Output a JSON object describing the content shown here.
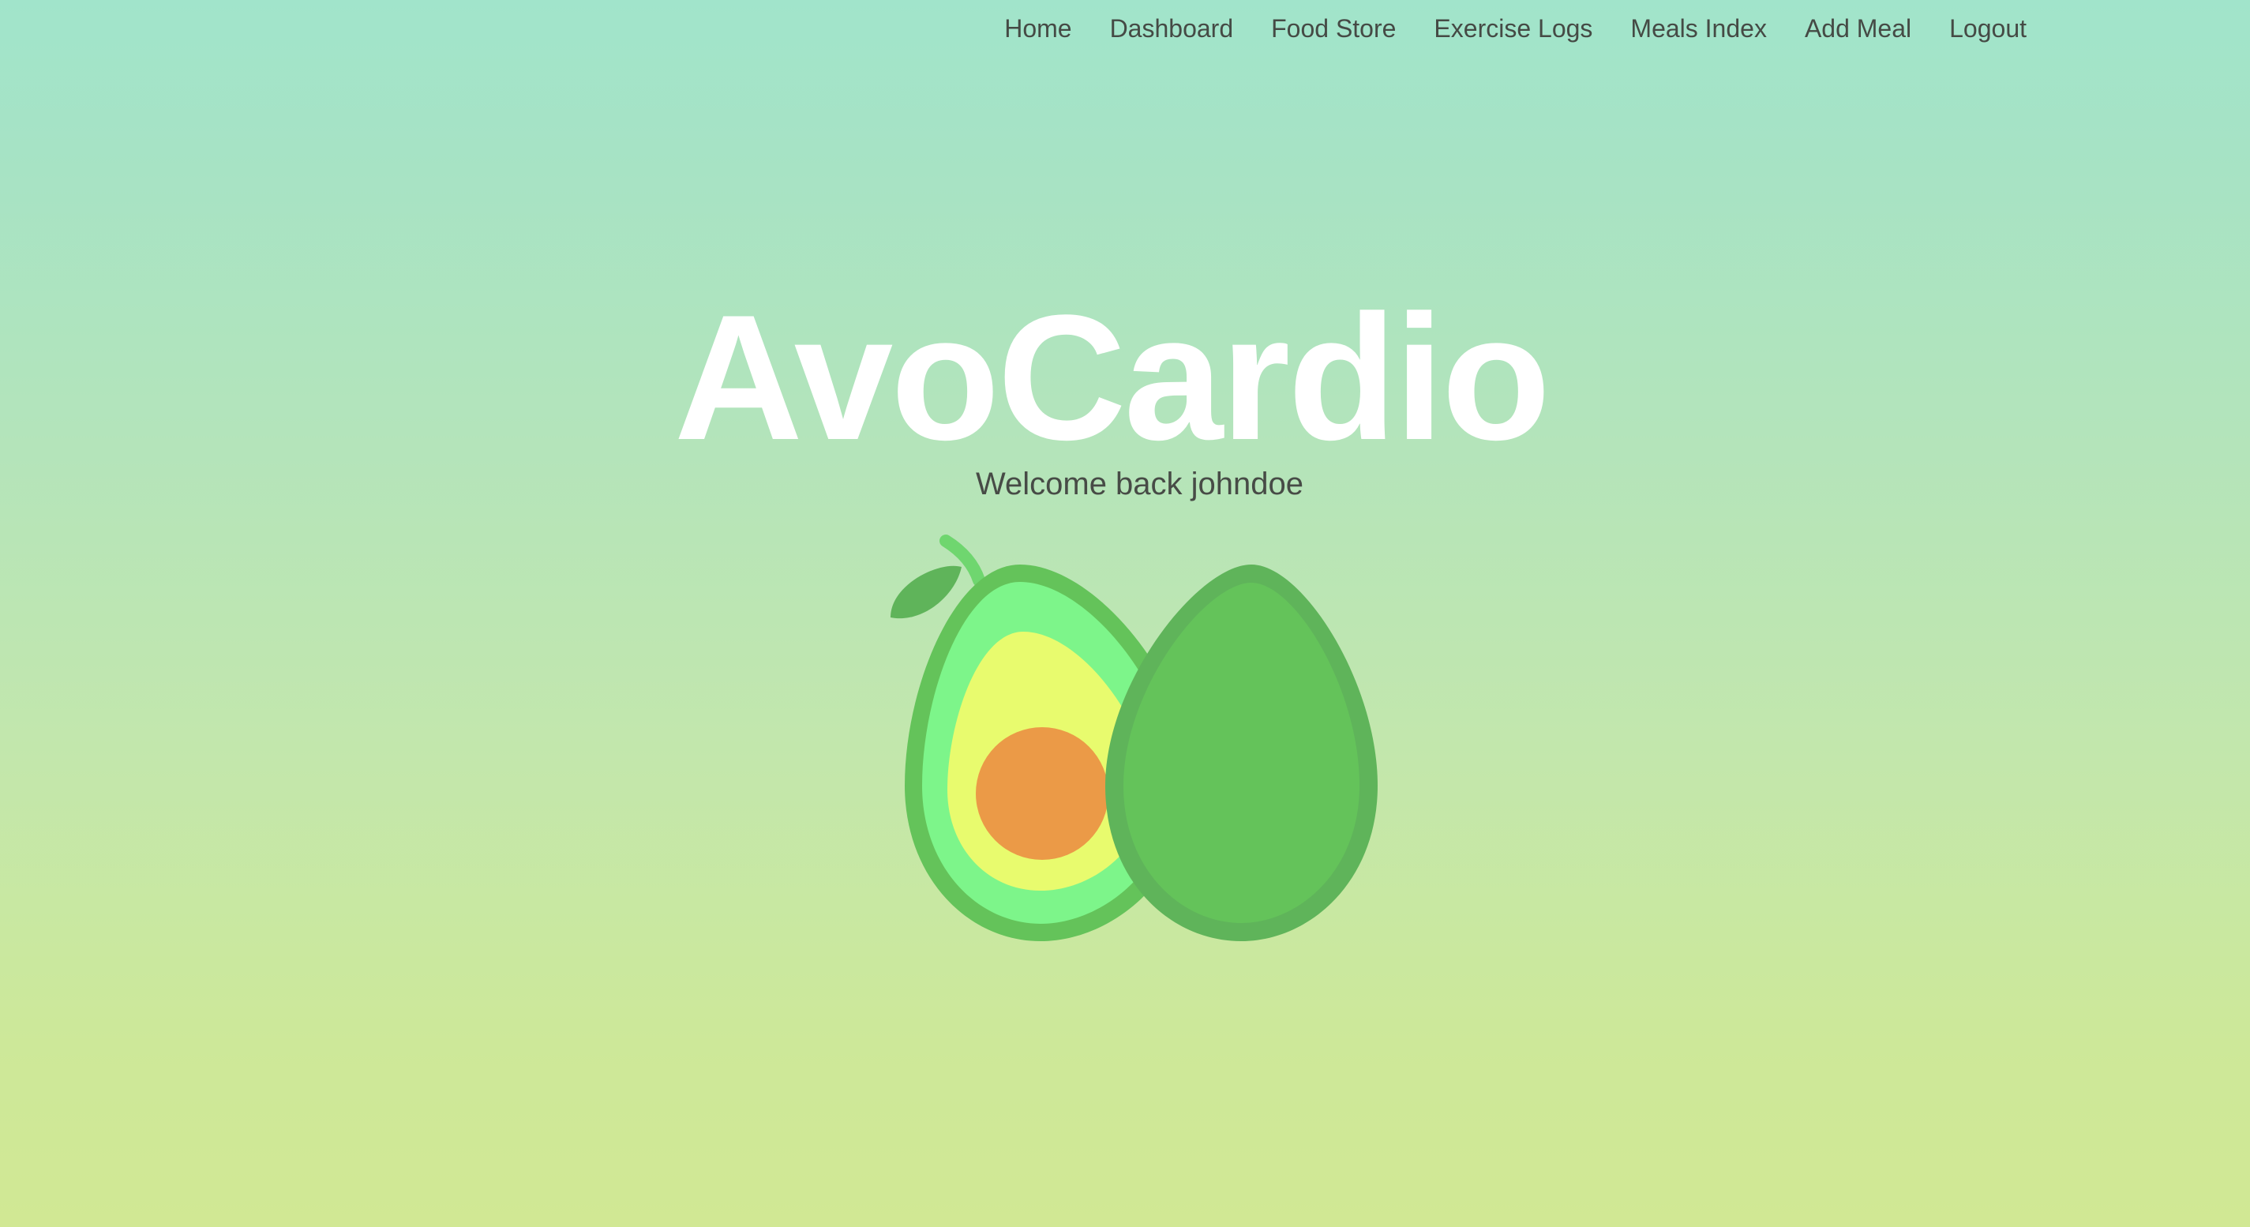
{
  "nav": {
    "items": [
      {
        "label": "Home"
      },
      {
        "label": "Dashboard"
      },
      {
        "label": "Food Store"
      },
      {
        "label": "Exercise Logs"
      },
      {
        "label": "Meals Index"
      },
      {
        "label": "Add Meal"
      },
      {
        "label": "Logout"
      }
    ]
  },
  "hero": {
    "title": "AvoCardio",
    "welcome": "Welcome back johndoe"
  },
  "colors": {
    "title": "#ffffff",
    "nav_text": "#454a45",
    "avocado_skin": "#62c25a",
    "avocado_flesh_outer": "#7df58a",
    "avocado_flesh_inner": "#e8fb6e",
    "avocado_pit": "#eb9a47"
  },
  "icons": {
    "logo": "avocado-icon"
  }
}
